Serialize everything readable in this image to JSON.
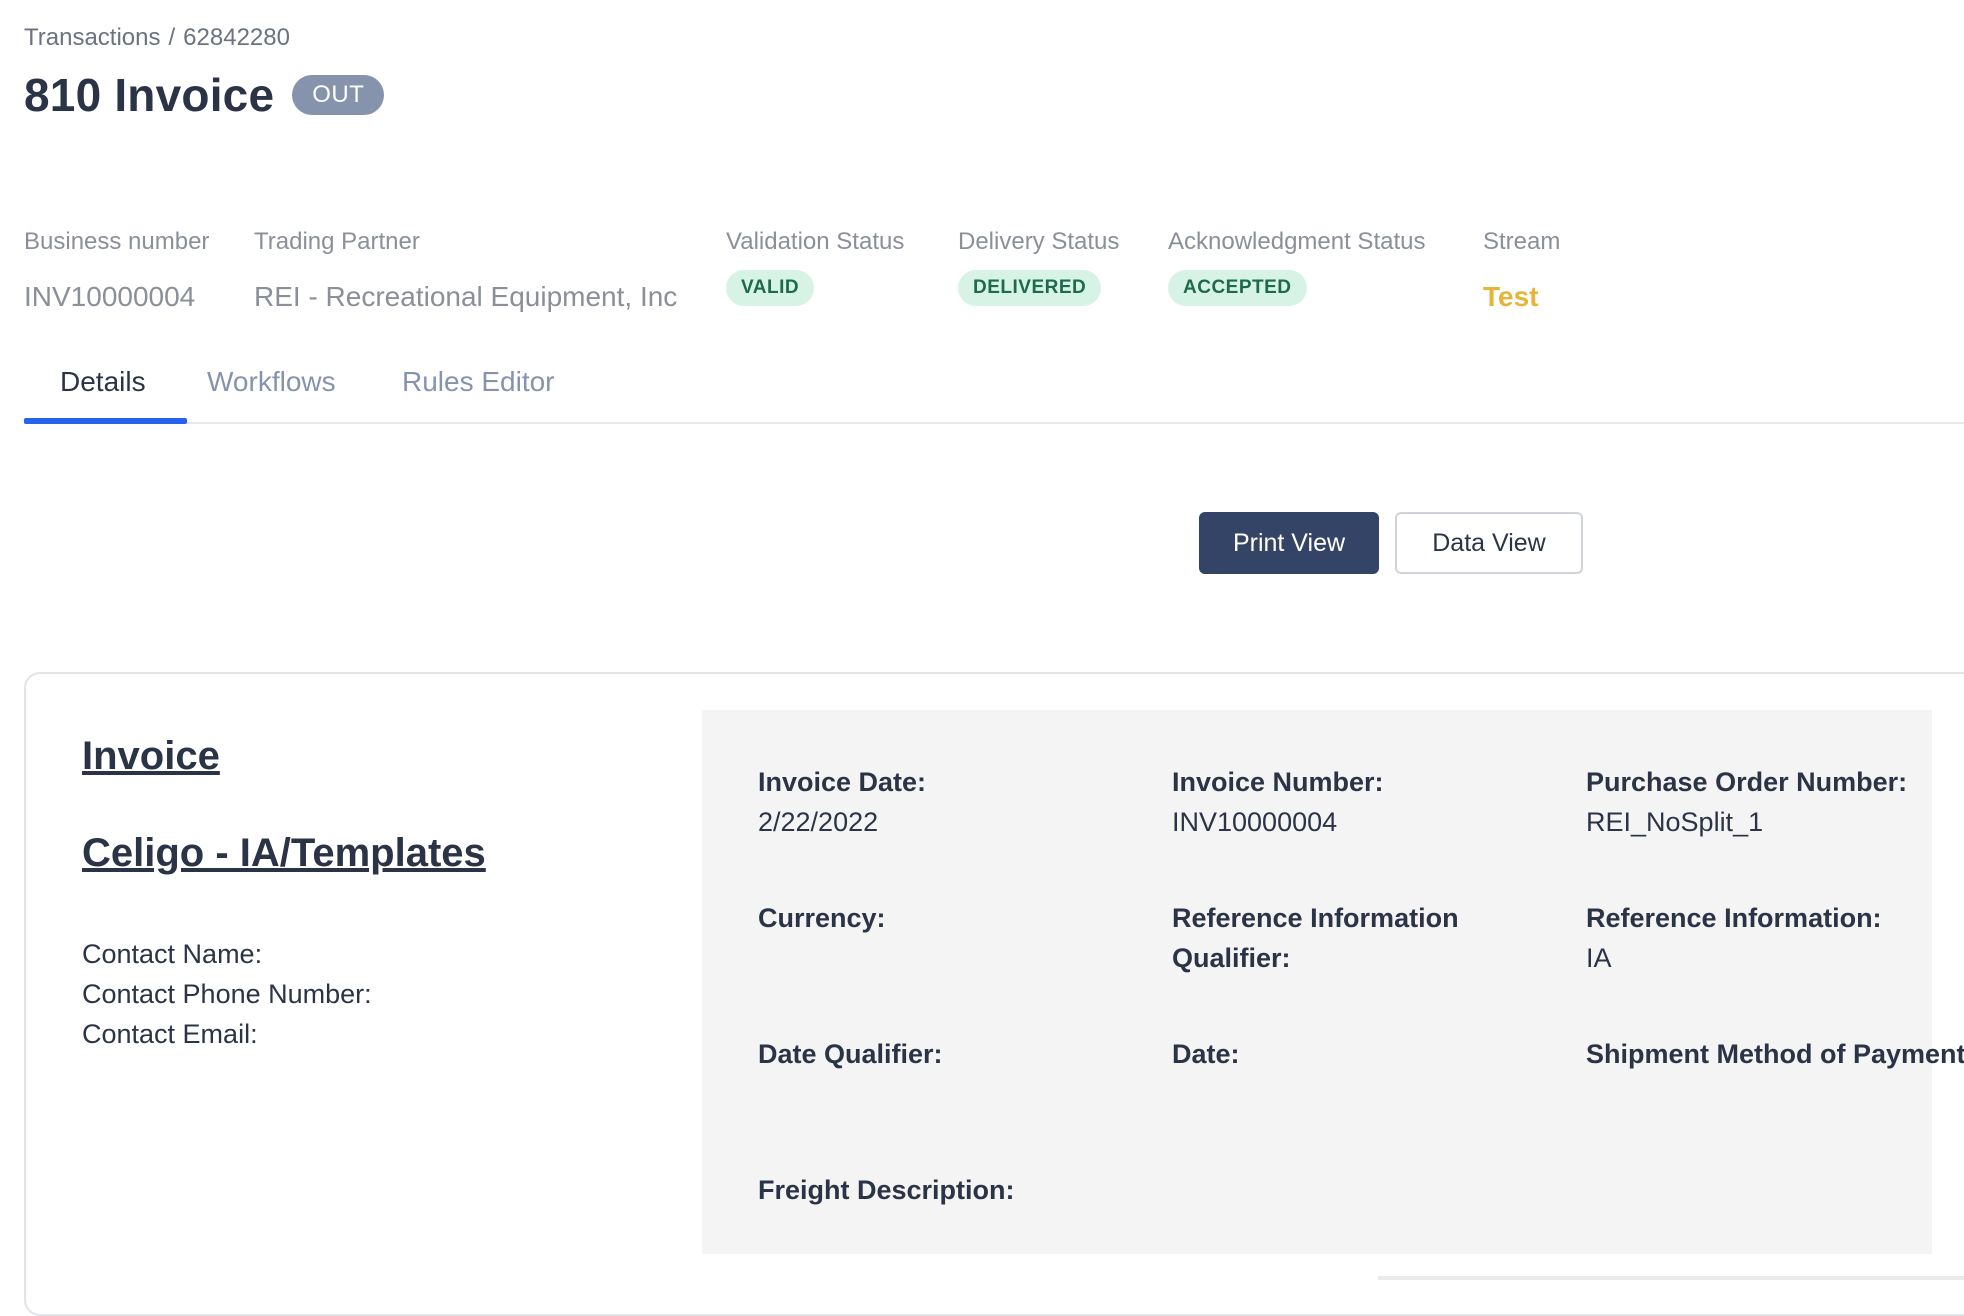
{
  "breadcrumb": {
    "root": "Transactions",
    "separator": "/",
    "current": "62842280"
  },
  "header": {
    "title": "810 Invoice",
    "direction_badge": "OUT"
  },
  "meta": {
    "business_number": {
      "label": "Business number",
      "value": "INV10000004"
    },
    "trading_partner": {
      "label": "Trading Partner",
      "value": "REI - Recreational Equipment, Inc"
    },
    "validation_status": {
      "label": "Validation Status",
      "value": "VALID"
    },
    "delivery_status": {
      "label": "Delivery Status",
      "value": "DELIVERED"
    },
    "acknowledgment_status": {
      "label": "Acknowledgment Status",
      "value": "ACCEPTED"
    },
    "stream": {
      "label": "Stream",
      "value": "Test"
    }
  },
  "tabs": [
    {
      "label": "Details",
      "active": true
    },
    {
      "label": "Workflows",
      "active": false
    },
    {
      "label": "Rules Editor",
      "active": false
    }
  ],
  "view_toggle": {
    "print_label": "Print View",
    "data_label": "Data View",
    "selected": "Print View"
  },
  "invoice": {
    "heading": "Invoice",
    "company": "Celigo - IA/Templates",
    "contact_name_label": "Contact Name:",
    "contact_phone_label": "Contact Phone Number:",
    "contact_email_label": "Contact Email:",
    "fields": {
      "invoice_date": {
        "label": "Invoice Date:",
        "value": "2/22/2022"
      },
      "invoice_number": {
        "label": "Invoice Number:",
        "value": "INV10000004"
      },
      "po_number": {
        "label": "Purchase Order Number:",
        "value": "REI_NoSplit_1"
      },
      "currency": {
        "label": "Currency:",
        "value": ""
      },
      "ref_info_qualifier": {
        "label": "Reference Information Qualifier:",
        "value": ""
      },
      "ref_info": {
        "label": "Reference Information:",
        "value": "IA"
      },
      "date_qualifier": {
        "label": "Date Qualifier:",
        "value": ""
      },
      "date": {
        "label": "Date:",
        "value": ""
      },
      "shipment_method": {
        "label": "Shipment Method of Payment:",
        "value": ""
      },
      "freight_description": {
        "label": "Freight Description:",
        "value": ""
      }
    }
  },
  "colors": {
    "primary_button": "#344466",
    "tab_active_underline": "#2563eb",
    "status_pill_bg": "#d6f3e6",
    "status_pill_text": "#1d6b4c",
    "stream_text": "#e5b53a",
    "out_badge": "#8593ad"
  }
}
